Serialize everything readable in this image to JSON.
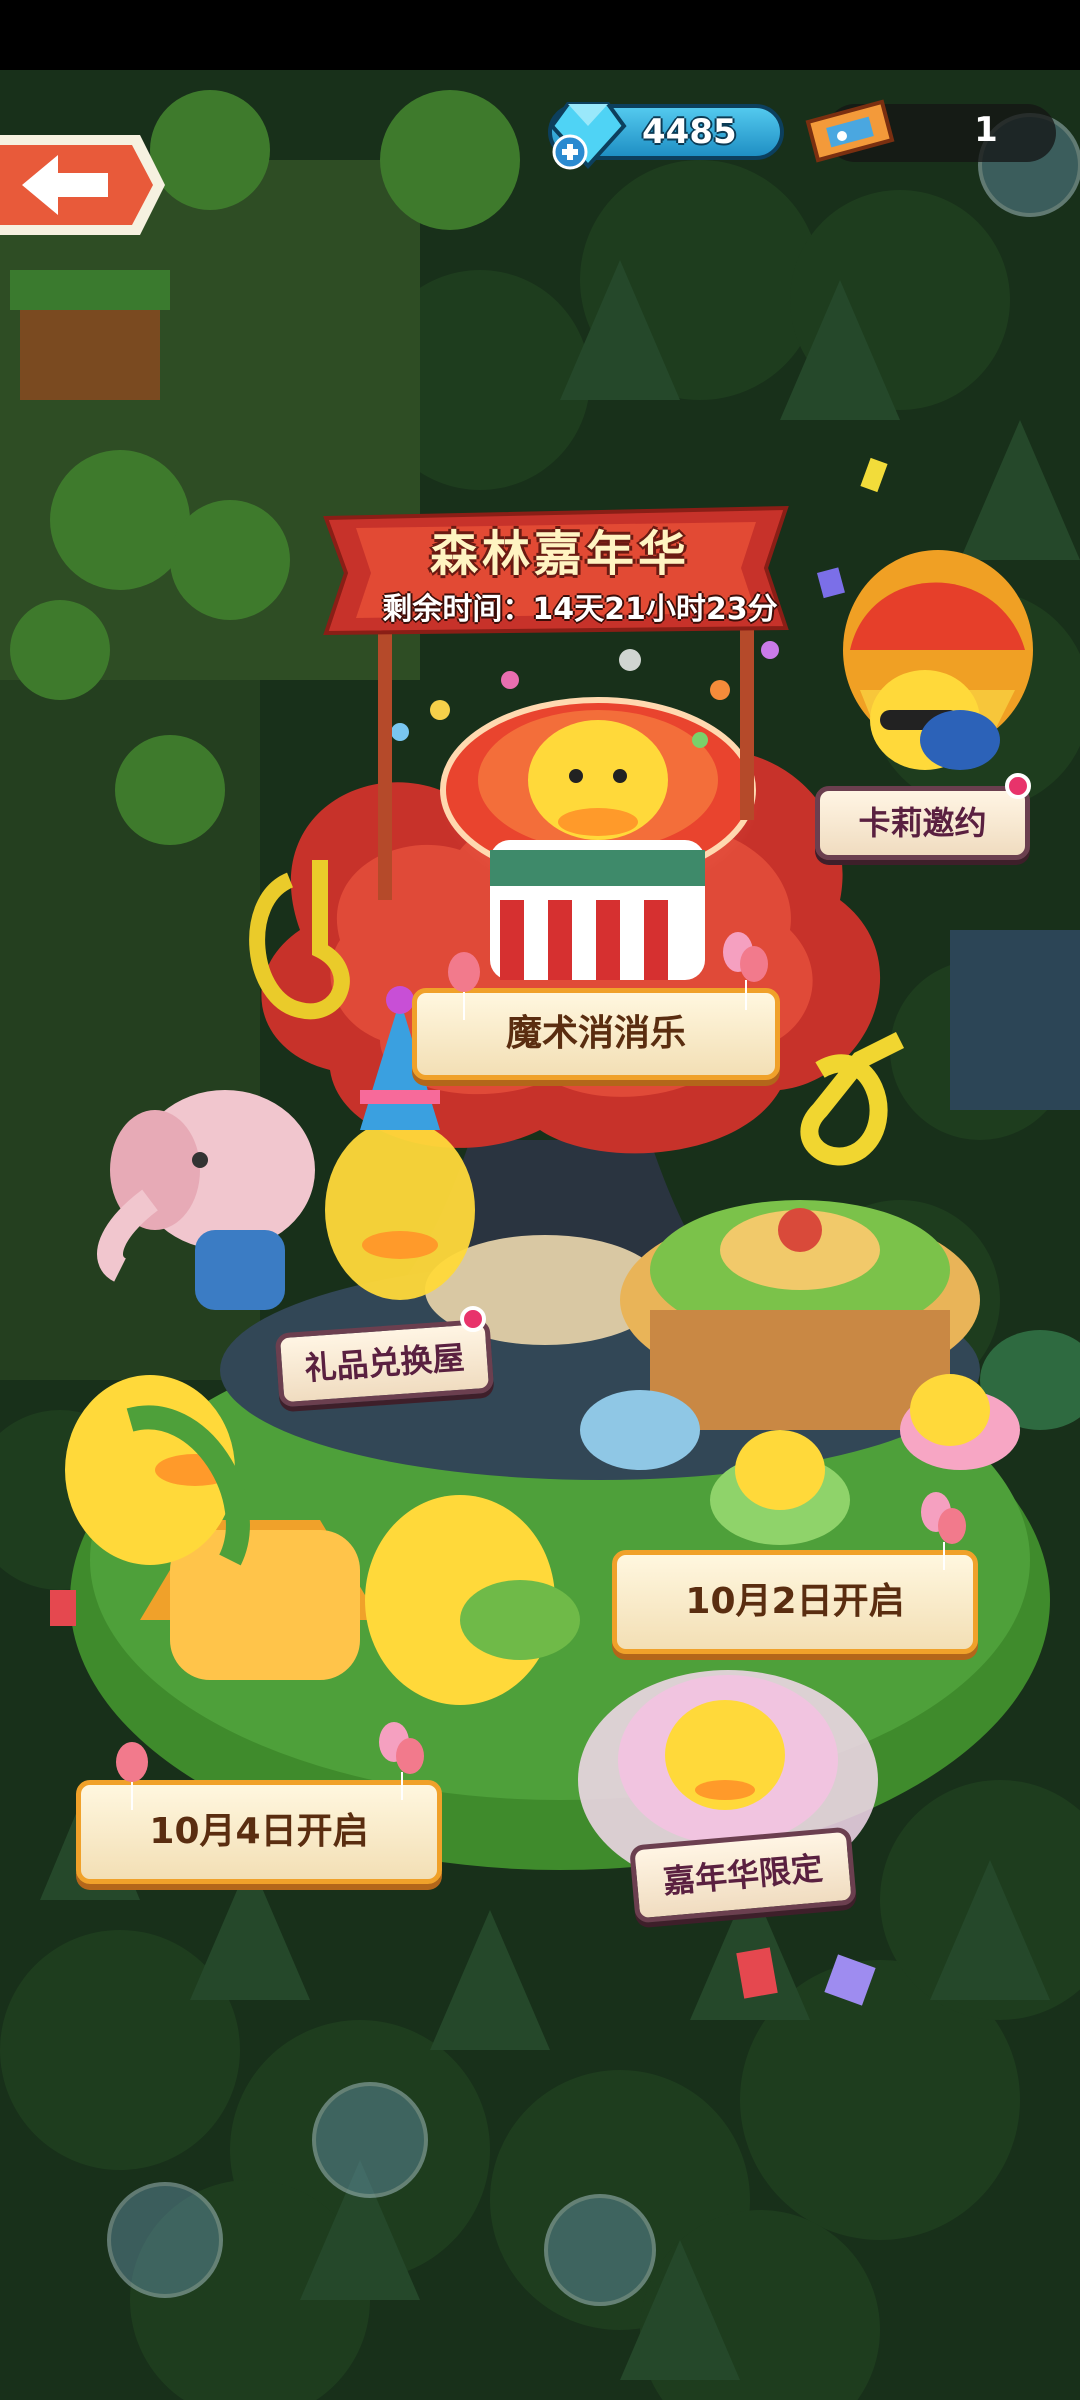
{
  "hud": {
    "gem_count": "4485",
    "ticket_count": "1"
  },
  "banner": {
    "title": "森林嘉年华",
    "remaining_time": "剩余时间：14天21小时23分"
  },
  "attractions": {
    "karl_invite": "卡莉邀约",
    "magic_match": "魔术消消乐",
    "gift_exchange": "礼品兑换屋",
    "teacup_ride": "10月2日开启",
    "seesaw_ride": "10月4日开启",
    "carnival_limited": "嘉年华限定"
  },
  "colors": {
    "accent_gold": "#f0a12a",
    "banner_red": "#c7322a",
    "notification_pink": "#e8336b",
    "gem_blue": "#2aa9dc"
  }
}
